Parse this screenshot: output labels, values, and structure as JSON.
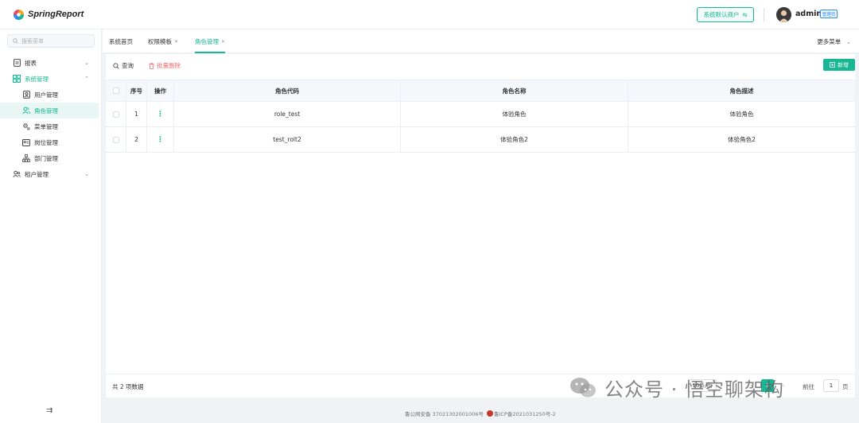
{
  "app": {
    "name": "SpringReport",
    "brand_color": "#17b794"
  },
  "header": {
    "tenant_button_label": "系统默认商户",
    "username": "admin",
    "role_badge": "管理员"
  },
  "sidebar": {
    "search_placeholder": "搜索菜单",
    "items": [
      {
        "label": "报表",
        "icon": "report-doc-icon",
        "expandable": true,
        "expanded": false
      },
      {
        "label": "系统管理",
        "icon": "grid-icon",
        "expandable": true,
        "expanded": true
      },
      {
        "label": "用户管理",
        "icon": "user-card-icon",
        "child": true
      },
      {
        "label": "角色管理",
        "icon": "users-icon",
        "child": true,
        "active": true
      },
      {
        "label": "菜单管理",
        "icon": "menu-gear-icon",
        "child": true
      },
      {
        "label": "岗位管理",
        "icon": "id-card-icon",
        "child": true
      },
      {
        "label": "部门管理",
        "icon": "org-tree-icon",
        "child": true
      },
      {
        "label": "租户管理",
        "icon": "tenant-users-icon",
        "expandable": true,
        "expanded": false
      }
    ]
  },
  "tabs": [
    {
      "label": "系统首页",
      "closable": false,
      "active": false
    },
    {
      "label": "权限模板",
      "closable": true,
      "active": false
    },
    {
      "label": "角色管理",
      "closable": true,
      "active": true
    }
  ],
  "more_menu_label": "更多菜单",
  "toolbar": {
    "query_label": "查询",
    "batch_delete_label": "批量删除",
    "add_label": "新增"
  },
  "table": {
    "columns": [
      "序号",
      "操作",
      "角色代码",
      "角色名称",
      "角色描述"
    ],
    "rows": [
      {
        "index": "1",
        "code": "role_test",
        "name": "体验角色",
        "desc": "体验角色"
      },
      {
        "index": "2",
        "code": "test_rolt2",
        "name": "体验角色2",
        "desc": "体验角色2"
      }
    ],
    "total_text": "共 2 项数据"
  },
  "pagination": {
    "page_size": "10条/页",
    "current_page": "1",
    "goto_label": "前往",
    "goto_value": "1",
    "unit_label": "页"
  },
  "watermark": "公众号 · 悟空聊架构",
  "footer": {
    "police_record": "鲁公网安备 37021302001006号",
    "icp_record": "鲁ICP备2021031250号-2"
  }
}
